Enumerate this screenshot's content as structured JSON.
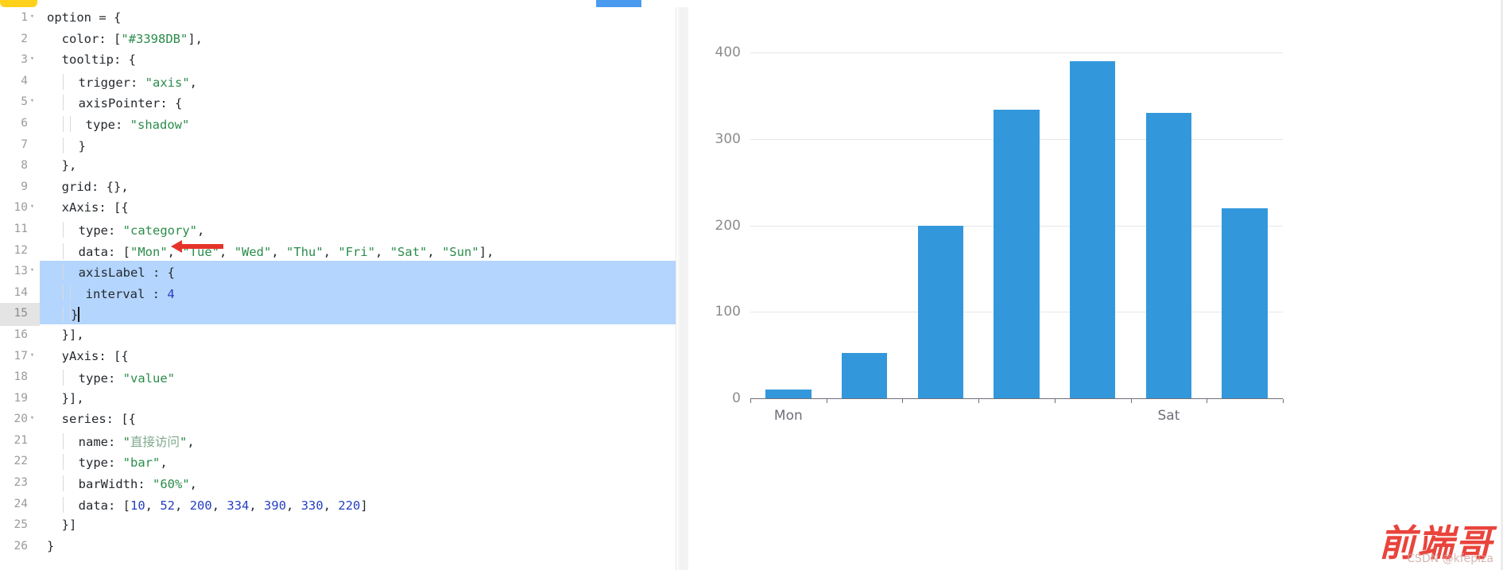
{
  "editor": {
    "tabs": {
      "yellow_tab": "",
      "blue_tab": ""
    },
    "lines": [
      {
        "n": "1",
        "fold": "▾",
        "indent": 0,
        "text": "option = {"
      },
      {
        "n": "2",
        "fold": "",
        "indent": 0,
        "text": "  color: [\"#3398DB\"],"
      },
      {
        "n": "3",
        "fold": "▾",
        "indent": 0,
        "text": "  tooltip: {"
      },
      {
        "n": "4",
        "fold": "",
        "indent": 1,
        "text": "    trigger: \"axis\","
      },
      {
        "n": "5",
        "fold": "▾",
        "indent": 1,
        "text": "    axisPointer: {"
      },
      {
        "n": "6",
        "fold": "",
        "indent": 2,
        "text": "      type: \"shadow\""
      },
      {
        "n": "7",
        "fold": "",
        "indent": 1,
        "text": "    }"
      },
      {
        "n": "8",
        "fold": "",
        "indent": 0,
        "text": "  },"
      },
      {
        "n": "9",
        "fold": "",
        "indent": 0,
        "text": "  grid: {},"
      },
      {
        "n": "10",
        "fold": "▾",
        "indent": 0,
        "text": "  xAxis: [{"
      },
      {
        "n": "11",
        "fold": "",
        "indent": 1,
        "text": "    type: \"category\","
      },
      {
        "n": "12",
        "fold": "",
        "indent": 1,
        "text": "    data: [\"Mon\", \"Tue\", \"Wed\", \"Thu\", \"Fri\", \"Sat\", \"Sun\"],"
      },
      {
        "n": "13",
        "fold": "▾",
        "indent": 1,
        "text": "    axisLabel : {"
      },
      {
        "n": "14",
        "fold": "",
        "indent": 2,
        "text": "      interval : 4"
      },
      {
        "n": "15",
        "fold": "",
        "indent": 2,
        "text": "    }"
      },
      {
        "n": "16",
        "fold": "",
        "indent": 0,
        "text": "  }],"
      },
      {
        "n": "17",
        "fold": "▾",
        "indent": 0,
        "text": "  yAxis: [{"
      },
      {
        "n": "18",
        "fold": "",
        "indent": 1,
        "text": "    type: \"value\""
      },
      {
        "n": "19",
        "fold": "",
        "indent": 0,
        "text": "  }],"
      },
      {
        "n": "20",
        "fold": "▾",
        "indent": 0,
        "text": "  series: [{"
      },
      {
        "n": "21",
        "fold": "",
        "indent": 1,
        "text": "    name: \"直接访问\","
      },
      {
        "n": "22",
        "fold": "",
        "indent": 1,
        "text": "    type: \"bar\","
      },
      {
        "n": "23",
        "fold": "",
        "indent": 1,
        "text": "    barWidth: \"60%\","
      },
      {
        "n": "24",
        "fold": "",
        "indent": 1,
        "text": "    data: [10, 52, 200, 334, 390, 330, 220]"
      },
      {
        "n": "25",
        "fold": "",
        "indent": 0,
        "text": "  }]"
      },
      {
        "n": "26",
        "fold": "",
        "indent": 0,
        "text": "}"
      }
    ],
    "selection": {
      "start_line": 13,
      "end_line": 15,
      "current_line": 15
    },
    "annotation": {
      "type": "red-arrow",
      "points_at": "interval : 4"
    }
  },
  "chart_data": {
    "type": "bar",
    "title": "",
    "categories": [
      "Mon",
      "Tue",
      "Wed",
      "Thu",
      "Fri",
      "Sat",
      "Sun"
    ],
    "values": [
      10,
      52,
      200,
      334,
      390,
      330,
      220
    ],
    "series": [
      {
        "name": "直接访问",
        "values": [
          10,
          52,
          200,
          334,
          390,
          330,
          220
        ]
      }
    ],
    "visible_xtick_labels": [
      "Mon",
      "Sat"
    ],
    "xtick_label_interval": 4,
    "ytick_labels": [
      "0",
      "100",
      "200",
      "300",
      "400"
    ],
    "ytick_values": [
      0,
      100,
      200,
      300,
      400
    ],
    "ylim": [
      0,
      400
    ],
    "xlabel": "",
    "ylabel": "",
    "grid": true,
    "legend": "none",
    "bar_color": "#3398db",
    "bar_width_percent": "60%"
  },
  "watermark": {
    "main": "前端哥",
    "sub": "CSDN @kfepiza"
  }
}
